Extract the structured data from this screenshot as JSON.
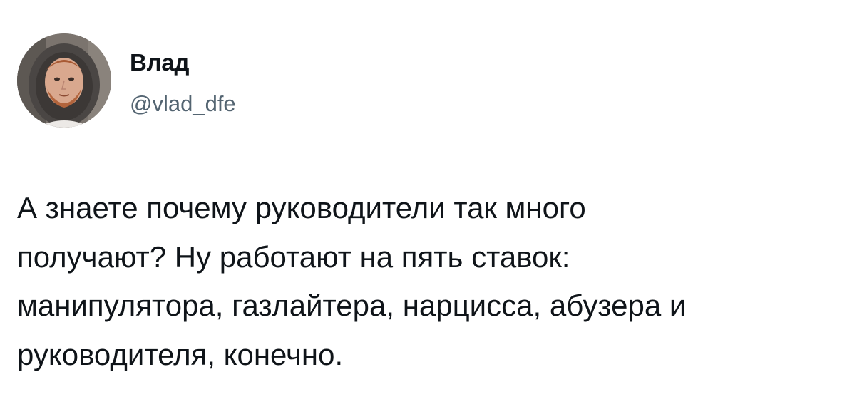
{
  "author": {
    "display_name": "Влад",
    "handle": "@vlad_dfe",
    "avatar_icon": "person-photo-avatar"
  },
  "tweet": {
    "lines": [
      "А знаете почему руководители так много",
      "получают? Ну работают на пять ставок:",
      "манипулятора, газлайтера, нарцисса, абузера и",
      "руководителя, конечно."
    ]
  },
  "colors": {
    "text": "#0f1419",
    "secondary_text": "#536471",
    "background": "#ffffff"
  }
}
